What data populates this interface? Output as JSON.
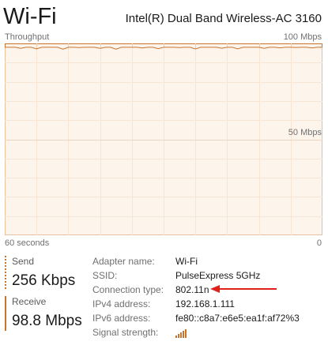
{
  "header": {
    "title": "Wi-Fi",
    "adapter": "Intel(R) Dual Band Wireless-AC 3160"
  },
  "graph": {
    "label": "Throughput",
    "max_label": "100 Mbps",
    "mid_label": "50 Mbps",
    "x_start_label": "60 seconds",
    "x_end_label": "0",
    "max_mbps": 100,
    "window_seconds": 60,
    "line_color": "#c7752e",
    "fill_color": "#fdf4ec",
    "series_mbps": [
      98,
      98,
      98,
      97.4,
      98,
      98,
      97.2,
      98,
      98,
      98,
      98,
      97,
      98,
      98,
      97.8,
      98,
      98,
      98,
      97.4,
      98,
      98,
      97,
      98,
      98,
      98,
      98,
      97.6,
      98,
      98,
      97.3,
      98,
      98,
      98,
      97.8,
      98,
      98,
      97.1,
      98,
      98,
      98,
      98,
      97.5,
      98,
      98,
      97.2,
      98,
      98,
      98,
      98,
      97.4,
      98,
      98,
      97.7,
      98,
      98,
      97.9,
      98,
      98,
      97.6,
      98,
      98
    ]
  },
  "stats": {
    "send_label": "Send",
    "send_value": "256 Kbps",
    "receive_label": "Receive",
    "receive_value": "98.8 Mbps",
    "accent_color": "#c7752e"
  },
  "details": [
    {
      "key": "Adapter name:",
      "value": "Wi-Fi"
    },
    {
      "key": "SSID:",
      "value": "PulseExpress 5GHz"
    },
    {
      "key": "Connection type:",
      "value": "802.11n"
    },
    {
      "key": "IPv4 address:",
      "value": "192.168.1.111"
    },
    {
      "key": "IPv6 address:",
      "value": "fe80::c8a7:e6e5:ea1f:af72%3"
    },
    {
      "key": "Signal strength:",
      "value": ""
    }
  ],
  "signal_bars": {
    "filled": 5,
    "total": 5,
    "icon": "signal-strength-icon"
  },
  "annotation": {
    "icon": "red-arrow-icon",
    "color": "#e0201a"
  }
}
